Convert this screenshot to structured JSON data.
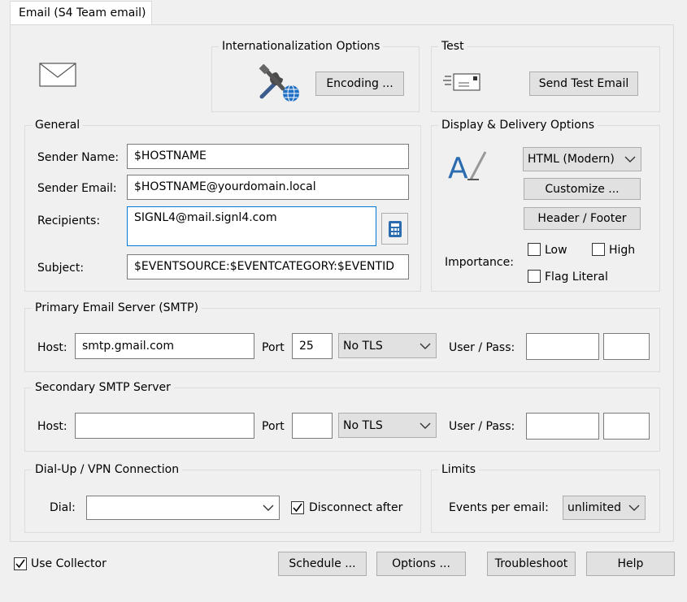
{
  "tab": {
    "label": "Email (S4 Team email)"
  },
  "internationalization": {
    "title": "Internationalization Options",
    "encoding_button": "Encoding ..."
  },
  "test": {
    "title": "Test",
    "send_button": "Send Test Email"
  },
  "general": {
    "title": "General",
    "sender_name_label": "Sender Name:",
    "sender_name_value": "$HOSTNAME",
    "sender_email_label": "Sender Email:",
    "sender_email_value": "$HOSTNAME@yourdomain.local",
    "recipients_label": "Recipients:",
    "recipients_value": "SIGNL4@mail.signl4.com",
    "subject_label": "Subject:",
    "subject_value": "$EVENTSOURCE:$EVENTCATEGORY:$EVENTID"
  },
  "display": {
    "title": "Display & Delivery Options",
    "format_selected": "HTML (Modern)",
    "customize_button": "Customize ...",
    "header_footer_button": "Header / Footer",
    "importance_label": "Importance:",
    "low_label": "Low",
    "high_label": "High",
    "flag_literal_label": "Flag Literal"
  },
  "primary_smtp": {
    "title": "Primary Email Server (SMTP)",
    "host_label": "Host:",
    "host_value": "smtp.gmail.com",
    "port_label": "Port",
    "port_value": "25",
    "tls_selected": "No TLS",
    "userpass_label": "User / Pass:"
  },
  "secondary_smtp": {
    "title": "Secondary SMTP Server",
    "host_label": "Host:",
    "host_value": "",
    "port_label": "Port",
    "port_value": "",
    "tls_selected": "No TLS",
    "userpass_label": "User / Pass:"
  },
  "dialup": {
    "title": "Dial-Up / VPN Connection",
    "dial_label": "Dial:",
    "dial_value": "",
    "disconnect_label": "Disconnect after"
  },
  "limits": {
    "title": "Limits",
    "events_label": "Events per email:",
    "events_selected": "unlimited"
  },
  "footer": {
    "use_collector_label": "Use Collector",
    "schedule_button": "Schedule ...",
    "options_button": "Options ...",
    "troubleshoot_button": "Troubleshoot",
    "help_button": "Help"
  },
  "colors": {
    "accent": "#0078d7",
    "button_face": "#e1e1e1",
    "button_border": "#adadad"
  }
}
